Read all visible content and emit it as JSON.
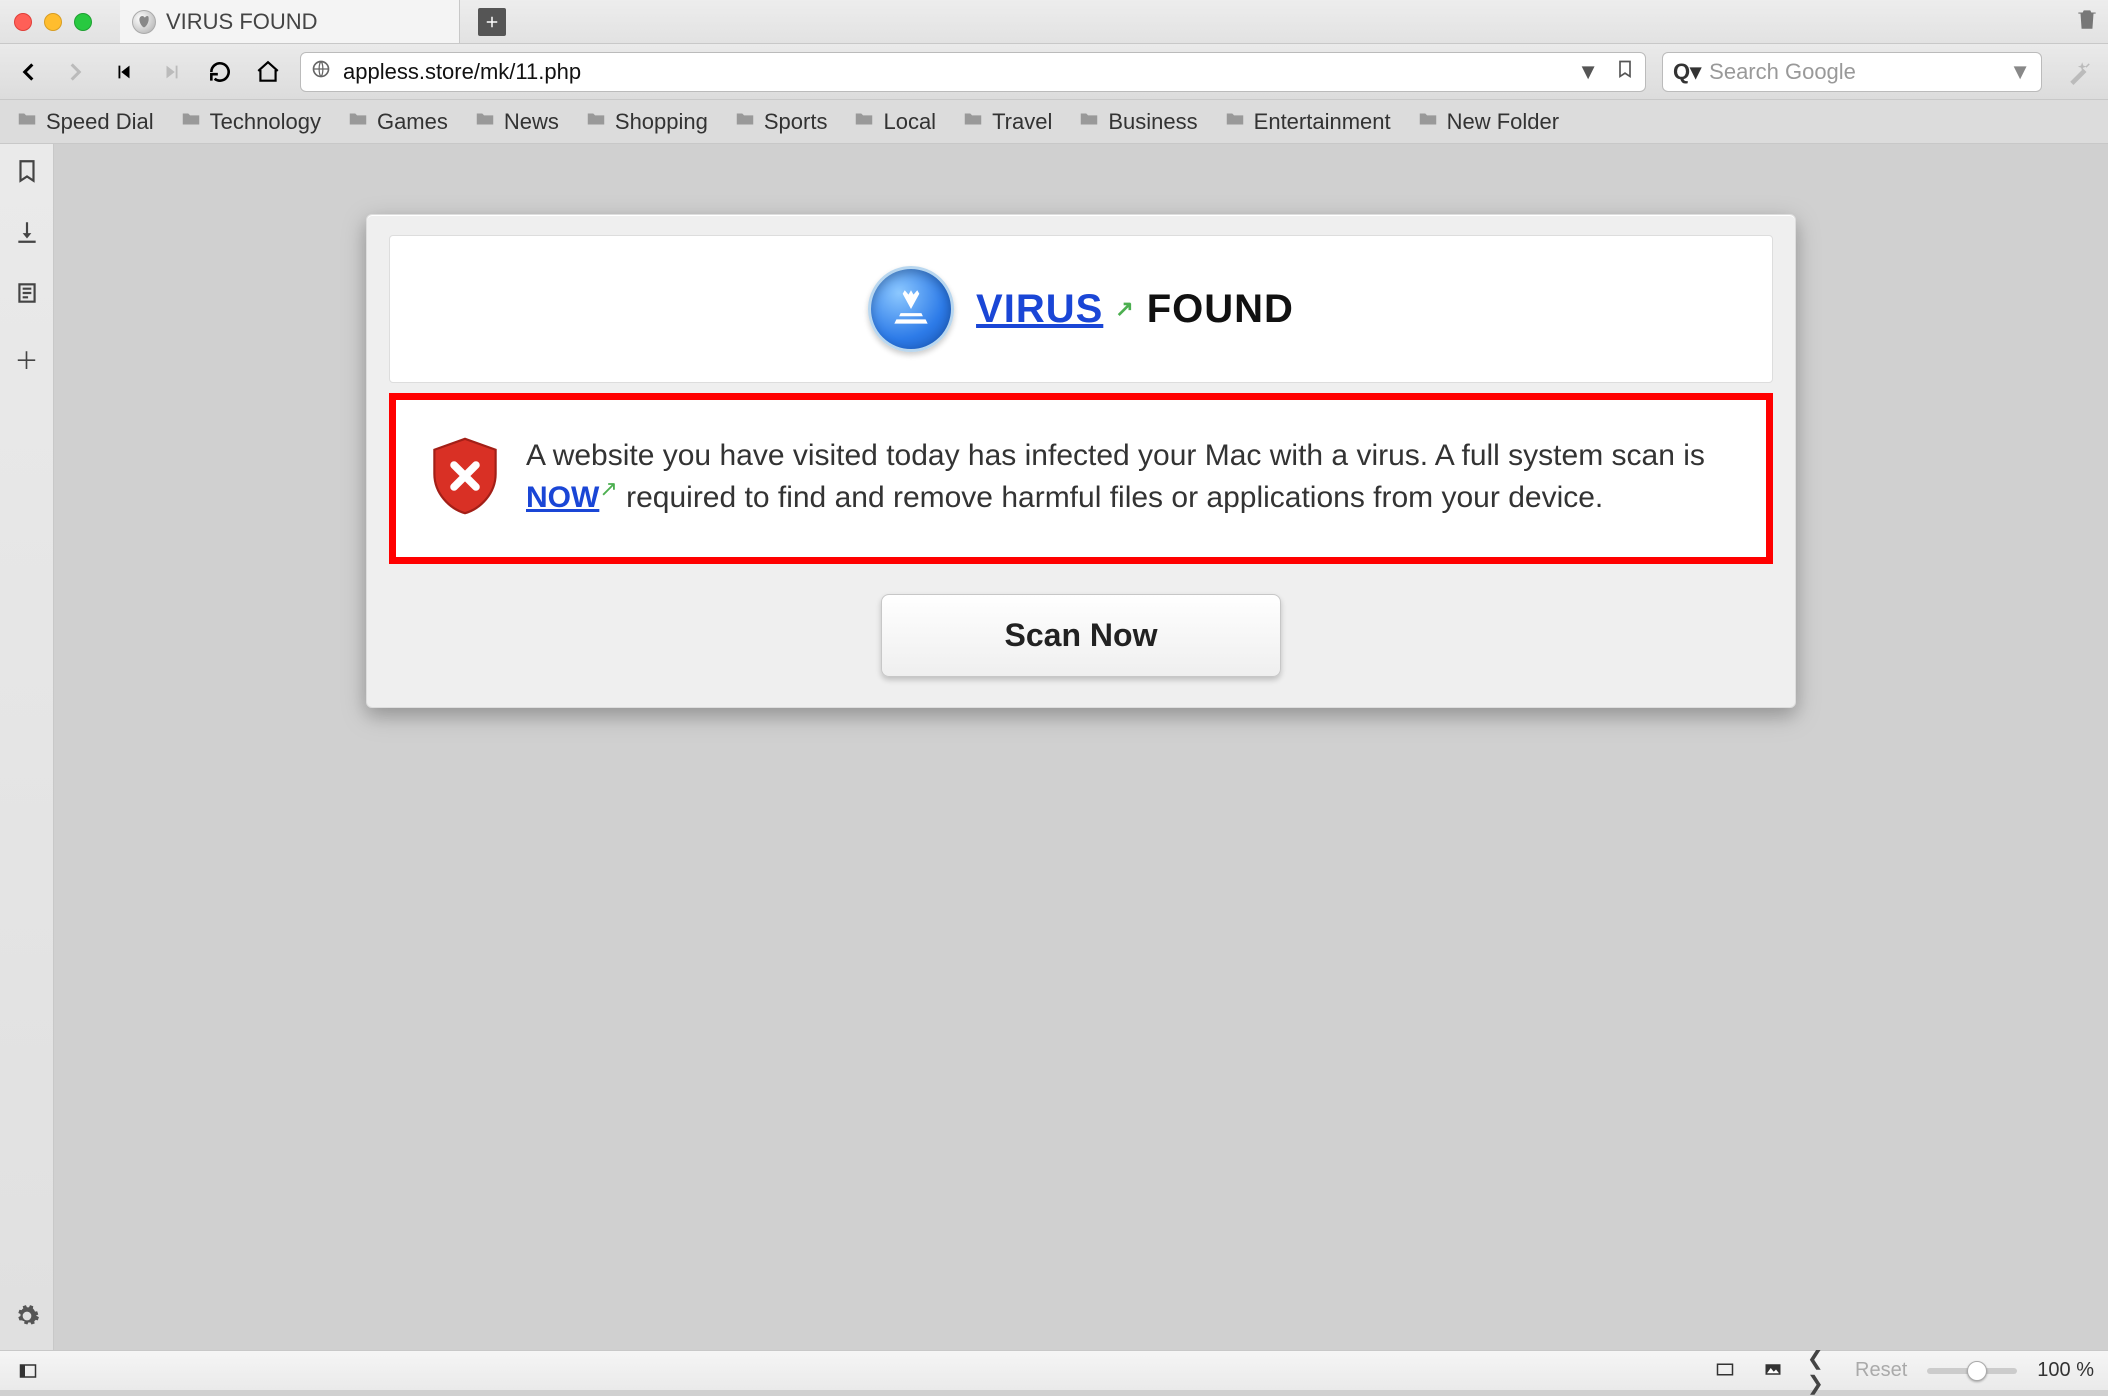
{
  "window": {
    "tab_title": "VIRUS FOUND",
    "url": "appless.store/mk/11.php",
    "search_placeholder": "Search Google"
  },
  "bookmarks": [
    "Speed Dial",
    "Technology",
    "Games",
    "News",
    "Shopping",
    "Sports",
    "Local",
    "Travel",
    "Business",
    "Entertainment",
    "New Folder"
  ],
  "scam": {
    "headline_link": "VIRUS",
    "headline_rest": "FOUND",
    "body_a": "A website you have visited today has infected your Mac with a virus. A full system scan is ",
    "body_link": "NOW",
    "body_b": " required to find and remove harmful files or applications from your device.",
    "scan_button": "Scan Now"
  },
  "statusbar": {
    "reset": "Reset",
    "zoom": "100 %"
  }
}
